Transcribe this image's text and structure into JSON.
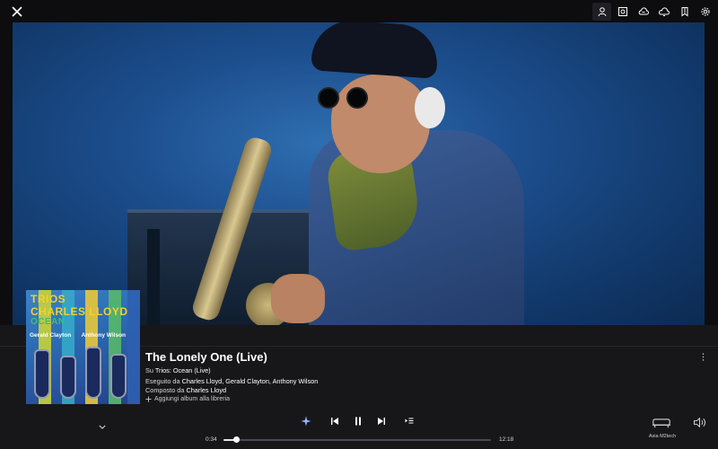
{
  "window": {
    "close_icon": "close-icon"
  },
  "toolbar": {
    "tools": [
      {
        "name": "artist-icon",
        "active": true
      },
      {
        "name": "album-icon",
        "active": false
      },
      {
        "name": "queue-cloud-icon",
        "active": false
      },
      {
        "name": "lyrics-icon",
        "active": false
      },
      {
        "name": "bookmark-icon",
        "active": false
      },
      {
        "name": "settings-gear-icon",
        "active": false
      }
    ]
  },
  "artwork": {
    "line1": "TRIOS",
    "line1b": "CHARLES LLOYD",
    "line2": "OCEAN",
    "names_left": "Gerald Clayton",
    "names_right": "Anthony Wilson"
  },
  "track": {
    "title": "The Lonely One (Live)",
    "album_prefix": "Su ",
    "album": "Trios: Ocean (Live)",
    "performed_prefix": "Eseguito da ",
    "performed_by": "Charles Lloyd, Gerald Clayton, Anthony Wilson",
    "composed_prefix": "Composto da ",
    "composed_by": "Charles Lloyd",
    "add_to_library": "Aggiungi album alla libreria"
  },
  "playback": {
    "elapsed": "0:34",
    "duration": "12:18",
    "progress_fraction": 0.046,
    "state": "playing"
  },
  "output": {
    "device_label": "Asia M2tech"
  },
  "colors": {
    "panel_bg": "#17171a",
    "accent_star": "#6fa8ff"
  }
}
